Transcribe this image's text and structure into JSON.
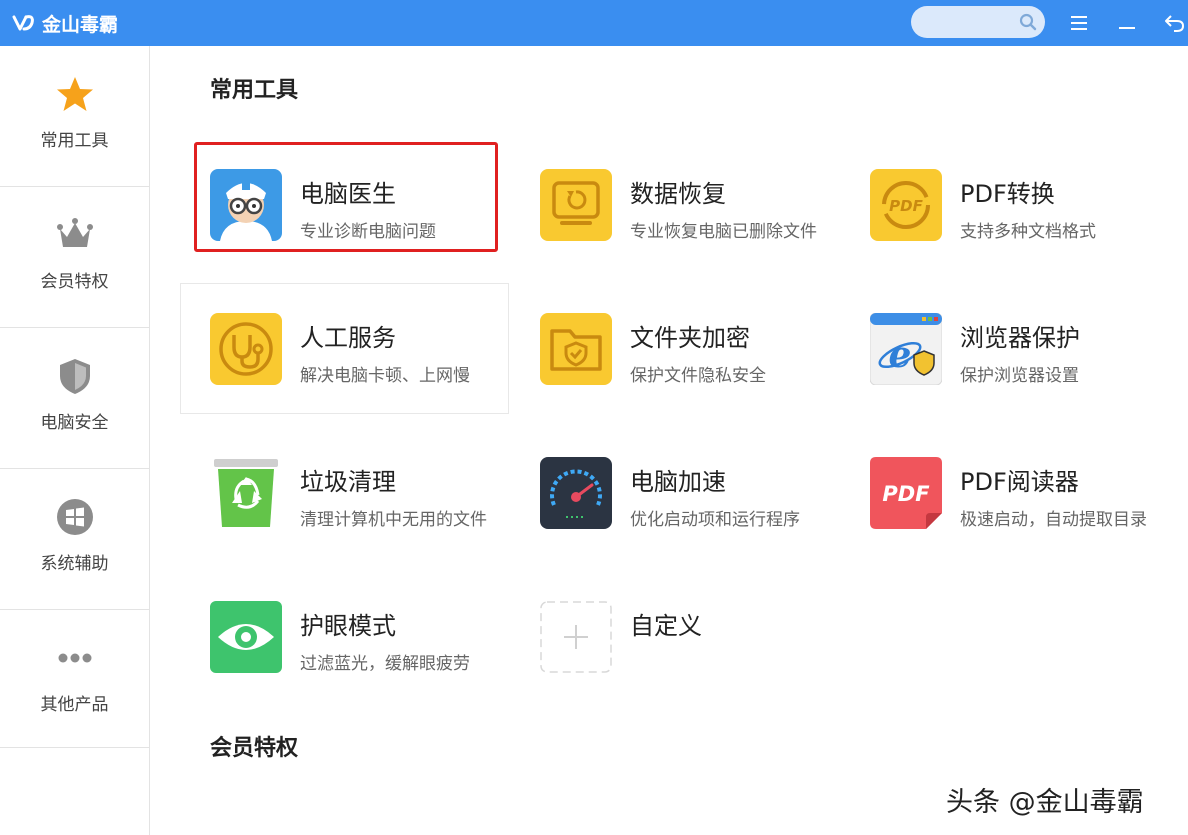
{
  "app": {
    "title": "金山毒霸"
  },
  "search": {
    "placeholder": ""
  },
  "sidebar": {
    "items": [
      {
        "label": "常用工具",
        "icon": "star-icon"
      },
      {
        "label": "会员特权",
        "icon": "crown-icon"
      },
      {
        "label": "电脑安全",
        "icon": "shield-icon"
      },
      {
        "label": "系统辅助",
        "icon": "windows-icon"
      },
      {
        "label": "其他产品",
        "icon": "more-dots-icon"
      }
    ]
  },
  "main": {
    "section_common": "常用工具",
    "section_member": "会员特权",
    "tools": [
      {
        "name": "电脑医生",
        "desc": "专业诊断电脑问题",
        "icon": "doctor-icon"
      },
      {
        "name": "数据恢复",
        "desc": "专业恢复电脑已删除文件",
        "icon": "data-recovery-icon"
      },
      {
        "name": "PDF转换",
        "desc": "支持多种文档格式",
        "icon": "pdf-convert-icon"
      },
      {
        "name": "人工服务",
        "desc": "解决电脑卡顿、上网慢",
        "icon": "stethoscope-icon"
      },
      {
        "name": "文件夹加密",
        "desc": "保护文件隐私安全",
        "icon": "folder-lock-icon"
      },
      {
        "name": "浏览器保护",
        "desc": "保护浏览器设置",
        "icon": "browser-shield-icon"
      },
      {
        "name": "垃圾清理",
        "desc": "清理计算机中无用的文件",
        "icon": "recycle-bin-icon"
      },
      {
        "name": "电脑加速",
        "desc": "优化启动项和运行程序",
        "icon": "speedometer-icon"
      },
      {
        "name": "PDF阅读器",
        "desc": "极速启动，自动提取目录",
        "icon": "pdf-reader-icon"
      },
      {
        "name": "护眼模式",
        "desc": "过滤蓝光，缓解眼疲劳",
        "icon": "eye-icon"
      },
      {
        "name": "自定义",
        "desc": "",
        "icon": "add-custom-icon"
      }
    ]
  },
  "pdf_icon_text": "PDF",
  "pdf_reader_icon_text": "PDF",
  "watermark": "头条 @金山毒霸",
  "colors": {
    "titlebar": "#3a8ef0",
    "accent_yellow": "#f9c930",
    "highlight_red": "#e02020",
    "pdf_red": "#f0555c",
    "eye_green": "#3ec46d"
  }
}
